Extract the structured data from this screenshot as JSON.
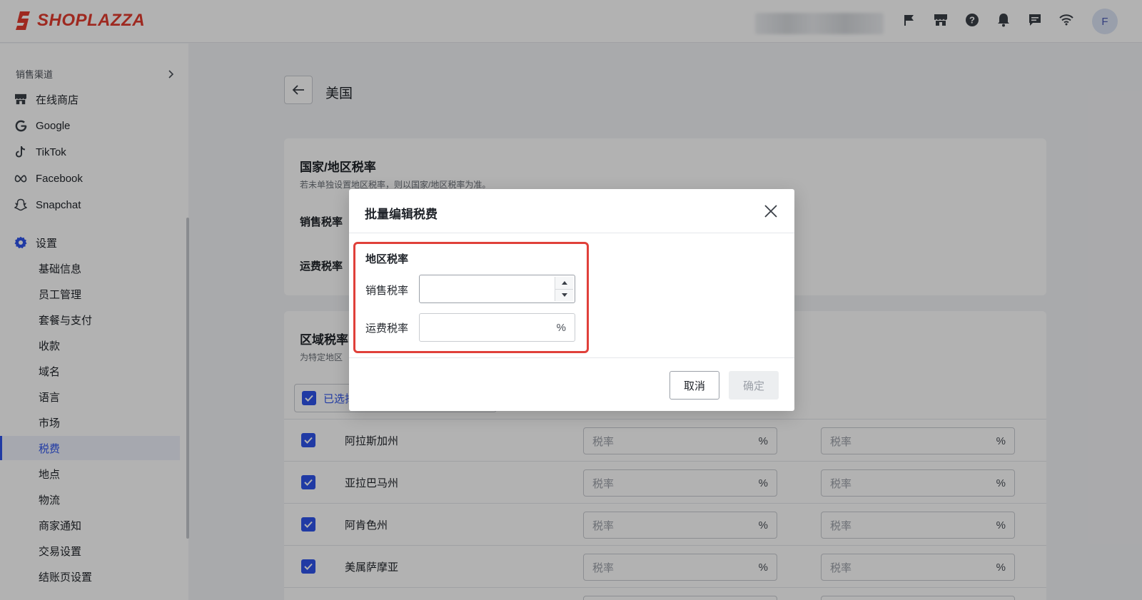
{
  "brand": {
    "name": "SHOPLAZZA",
    "color": "#e23b2e"
  },
  "header": {
    "icons": [
      "flag-icon",
      "store-icon",
      "help-icon",
      "bell-icon",
      "chat-icon",
      "wifi-icon"
    ],
    "avatar_initial": "F"
  },
  "sidebar": {
    "section_label": "销售渠道",
    "channels": [
      {
        "label": "在线商店",
        "icon": "store-icon"
      },
      {
        "label": "Google",
        "icon": "google-icon"
      },
      {
        "label": "TikTok",
        "icon": "tiktok-icon"
      },
      {
        "label": "Facebook",
        "icon": "meta-icon"
      },
      {
        "label": "Snapchat",
        "icon": "snapchat-icon"
      }
    ],
    "settings_label": "设置",
    "settings_items": [
      "基础信息",
      "员工管理",
      "套餐与支付",
      "收款",
      "域名",
      "语言",
      "市场",
      "税费",
      "地点",
      "物流",
      "商家通知",
      "交易设置",
      "结账页设置"
    ],
    "active_item": "税费"
  },
  "page": {
    "title": "美国",
    "country_card": {
      "title": "国家/地区税率",
      "desc": "若未单独设置地区税率，则以国家/地区税率为准。",
      "sales_label": "销售税率",
      "shipping_label": "运费税率"
    },
    "region_card": {
      "title": "区域税率",
      "desc": "为特定地区",
      "selected_label": "已选择"
    },
    "rows": [
      {
        "name": "阿拉斯加州",
        "sales_placeholder": "税率",
        "shipping_placeholder": "税率",
        "unit": "%"
      },
      {
        "name": "亚拉巴马州",
        "sales_placeholder": "税率",
        "shipping_placeholder": "税率",
        "unit": "%"
      },
      {
        "name": "阿肯色州",
        "sales_placeholder": "税率",
        "shipping_placeholder": "税率",
        "unit": "%"
      },
      {
        "name": "美属萨摩亚",
        "sales_placeholder": "税率",
        "shipping_placeholder": "税率",
        "unit": "%"
      }
    ]
  },
  "modal": {
    "title": "批量编辑税费",
    "section_title": "地区税率",
    "sales_label": "销售税率",
    "sales_value": "",
    "shipping_label": "运费税率",
    "shipping_value": "",
    "unit": "%",
    "cancel_label": "取消",
    "ok_label": "确定",
    "highlight_color": "#e0403a"
  },
  "colors": {
    "accent": "#2f54eb"
  }
}
